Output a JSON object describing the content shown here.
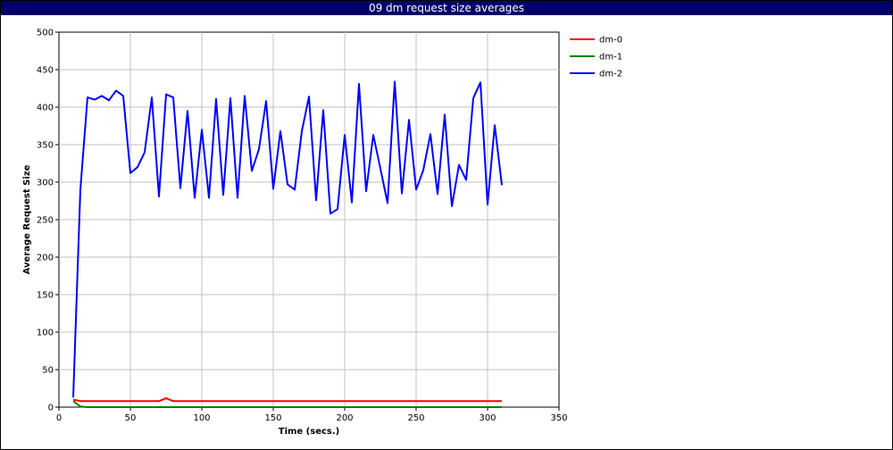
{
  "chart_data": {
    "type": "line",
    "title": "09 dm request size averages",
    "xlabel": "Time (secs.)",
    "ylabel": "Average Request Size",
    "xlim": [
      0,
      350
    ],
    "ylim": [
      0,
      500
    ],
    "xticks": [
      0,
      50,
      100,
      150,
      200,
      250,
      300,
      350
    ],
    "yticks": [
      0,
      50,
      100,
      150,
      200,
      250,
      300,
      350,
      400,
      450,
      500
    ],
    "grid": true,
    "legend_position": "right",
    "series": [
      {
        "name": "dm-0",
        "color": "#ff0000",
        "x": [
          10,
          15,
          20,
          25,
          30,
          35,
          40,
          45,
          50,
          55,
          60,
          65,
          70,
          75,
          80,
          85,
          90,
          95,
          100,
          150,
          200,
          250,
          300,
          310
        ],
        "y": [
          10,
          8,
          8,
          8,
          8,
          8,
          8,
          8,
          8,
          8,
          8,
          8,
          8,
          12,
          8,
          8,
          8,
          8,
          8,
          8,
          8,
          8,
          8,
          8
        ]
      },
      {
        "name": "dm-1",
        "color": "#008000",
        "x": [
          10,
          15,
          20,
          50,
          100,
          150,
          200,
          250,
          300,
          310
        ],
        "y": [
          8,
          1,
          0,
          0,
          0,
          0,
          0,
          0,
          0,
          0
        ]
      },
      {
        "name": "dm-2",
        "color": "#0000ff",
        "x": [
          10,
          15,
          20,
          25,
          30,
          35,
          40,
          45,
          50,
          55,
          60,
          65,
          70,
          75,
          80,
          85,
          90,
          95,
          100,
          105,
          110,
          115,
          120,
          125,
          130,
          135,
          140,
          145,
          150,
          155,
          160,
          165,
          170,
          175,
          180,
          185,
          190,
          195,
          200,
          205,
          210,
          215,
          220,
          225,
          230,
          235,
          240,
          245,
          250,
          255,
          260,
          265,
          270,
          275,
          280,
          285,
          290,
          295,
          300,
          305,
          310
        ],
        "y": [
          13,
          290,
          413,
          410,
          415,
          409,
          422,
          415,
          312,
          320,
          340,
          413,
          281,
          417,
          413,
          292,
          395,
          279,
          370,
          279,
          411,
          283,
          412,
          279,
          415,
          315,
          344,
          408,
          291,
          368,
          297,
          290,
          368,
          414,
          276,
          396,
          258,
          264,
          363,
          273,
          431,
          288,
          363,
          318,
          272,
          434,
          285,
          383,
          290,
          316,
          364,
          284,
          390,
          268,
          323,
          303,
          412,
          433,
          270,
          376,
          296
        ]
      }
    ]
  }
}
